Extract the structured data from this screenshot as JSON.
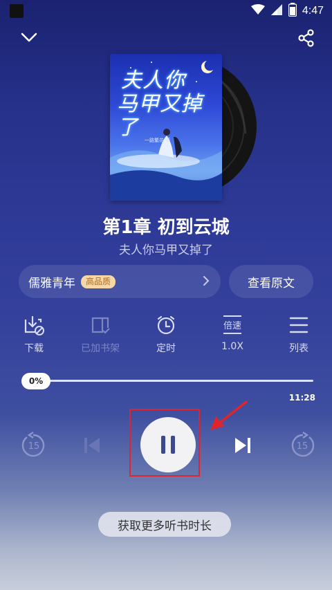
{
  "status_bar": {
    "time": "4:47"
  },
  "book": {
    "cover_title_line1": "夫人你",
    "cover_title_line2": "马甲又掉了",
    "cover_author": "一路繁花 著",
    "chapter_title": "第1章 初到云城",
    "book_title": "夫人你马甲又掉了"
  },
  "voice": {
    "name": "儒雅青年",
    "quality_badge": "高品质"
  },
  "original_button_label": "查看原文",
  "actions": [
    {
      "label": "下载",
      "icon": "download-icon",
      "enabled": true
    },
    {
      "label": "已加书架",
      "icon": "bookshelf-icon",
      "enabled": false
    },
    {
      "label": "定时",
      "icon": "timer-icon",
      "enabled": true
    },
    {
      "label": "1.0X",
      "icon": "speed-icon",
      "badge": "倍速",
      "enabled": true
    },
    {
      "label": "列表",
      "icon": "list-icon",
      "enabled": true
    }
  ],
  "progress": {
    "label": "0%",
    "value": 0,
    "total_time": "11:28"
  },
  "controls": {
    "rewind_seconds": "15",
    "forward_seconds": "15",
    "state": "playing"
  },
  "more_time_button_label": "获取更多听书时长",
  "colors": {
    "annotation_red": "#e0242b",
    "badge_bg": "#f6d8a8",
    "badge_text": "#b06a1c"
  }
}
